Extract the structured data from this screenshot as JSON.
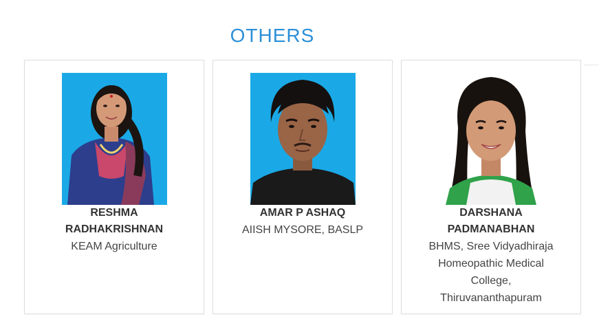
{
  "section": {
    "title": "OTHERS"
  },
  "cards": [
    {
      "name_line1": "RESHMA",
      "name_line2": "RADHAKRISHNAN",
      "info": "KEAM Agriculture",
      "photo_bg": "#1aa9e6"
    },
    {
      "name_line1": "AMAR P ASHAQ",
      "info": "AIISH MYSORE, BASLP",
      "photo_bg": "#1aa9e6"
    },
    {
      "name_line1": "DARSHANA",
      "name_line2": "PADMANABHAN",
      "info_line1": "BHMS, Sree Vidyadhiraja",
      "info_line2": "Homeopathic Medical",
      "info_line3": "College,",
      "info_line4": "Thiruvananthapuram",
      "photo_bg": "#ffffff"
    }
  ],
  "colors": {
    "title": "#2b8fd8",
    "card_border": "#dedede"
  }
}
